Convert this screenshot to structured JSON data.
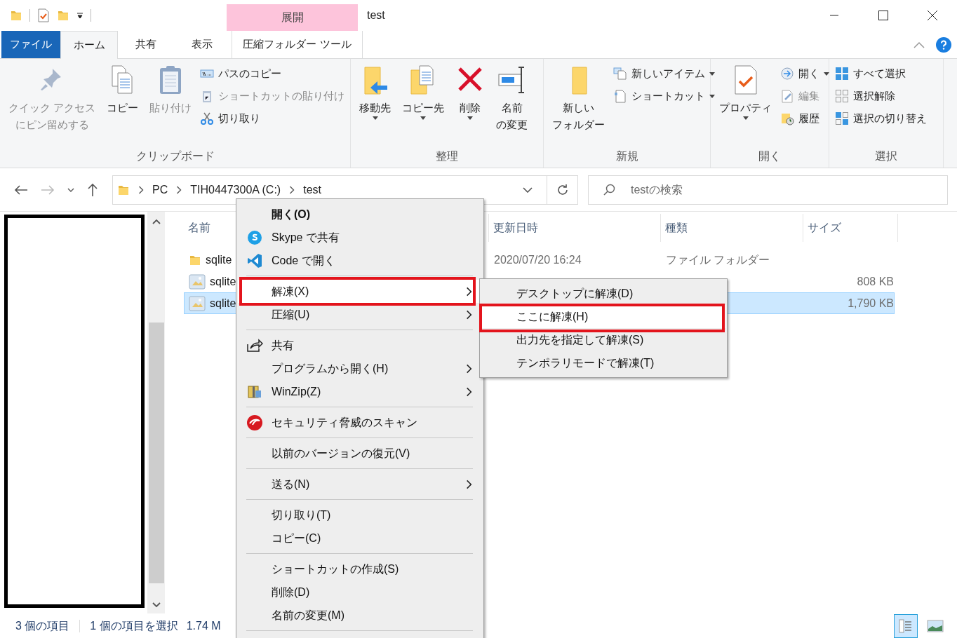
{
  "window": {
    "title": "test"
  },
  "contextual_group": {
    "label": "展開",
    "tab": {
      "label": "圧縮フォルダー ツール",
      "selected": false
    }
  },
  "tabs": [
    {
      "label": "ファイル",
      "kind": "file",
      "selected": false
    },
    {
      "label": "ホーム",
      "kind": "tab",
      "selected": true
    },
    {
      "label": "共有",
      "kind": "tab",
      "selected": false
    },
    {
      "label": "表示",
      "kind": "tab",
      "selected": false
    }
  ],
  "ribbon": [
    {
      "label": "クリップボード",
      "large": [
        {
          "lines": [
            "クイック アクセス",
            "にピン留めする"
          ],
          "disabled": true,
          "dropdown": false
        },
        {
          "label": "コピー",
          "disabled": false,
          "dropdown": false
        },
        {
          "label": "貼り付け",
          "disabled": true,
          "dropdown": false
        }
      ],
      "small": [
        {
          "label": "パスのコピー",
          "disabled": false,
          "dropdown": false
        },
        {
          "label": "ショートカットの貼り付け",
          "disabled": true,
          "dropdown": false
        },
        {
          "label": "切り取り",
          "disabled": false,
          "dropdown": false
        }
      ]
    },
    {
      "label": "整理",
      "large": [
        {
          "label": "移動先",
          "disabled": false,
          "dropdown": true
        },
        {
          "label": "コピー先",
          "disabled": false,
          "dropdown": true
        },
        {
          "label": "削除",
          "disabled": false,
          "dropdown": true
        },
        {
          "lines": [
            "名前",
            "の変更"
          ],
          "disabled": false,
          "dropdown": false
        }
      ]
    },
    {
      "label": "新規",
      "large": [
        {
          "lines": [
            "新しい",
            "フォルダー"
          ],
          "disabled": false,
          "dropdown": false
        }
      ],
      "small": [
        {
          "label": "新しいアイテム",
          "disabled": false,
          "dropdown": true
        },
        {
          "label": "ショートカット",
          "disabled": false,
          "dropdown": true
        }
      ]
    },
    {
      "label": "開く",
      "large": [
        {
          "label": "プロパティ",
          "disabled": false,
          "dropdown": true
        }
      ],
      "small": [
        {
          "label": "開く",
          "disabled": false,
          "dropdown": true
        },
        {
          "label": "編集",
          "disabled": true,
          "dropdown": false
        },
        {
          "label": "履歴",
          "disabled": false,
          "dropdown": false
        }
      ]
    },
    {
      "label": "選択",
      "small": [
        {
          "label": "すべて選択",
          "disabled": false,
          "dropdown": false
        },
        {
          "label": "選択解除",
          "disabled": false,
          "dropdown": false
        },
        {
          "label": "選択の切り替え",
          "disabled": false,
          "dropdown": false
        }
      ]
    }
  ],
  "address": {
    "segments": [
      "PC",
      "TIH0447300A (C:)",
      "test"
    ]
  },
  "search": {
    "placeholder": "testの検索"
  },
  "columns": [
    "名前",
    "更新日時",
    "種類",
    "サイズ"
  ],
  "rows": [
    {
      "name": "sqlite",
      "kind": "folder",
      "date": "2020/07/20 16:24",
      "type": "ファイル フォルダー",
      "selected": false
    },
    {
      "name": "sqlite",
      "kind": "archive",
      "size": "808 KB",
      "selected": false
    },
    {
      "name": "sqlite",
      "kind": "archive",
      "size": "1,790 KB",
      "selected": true
    }
  ],
  "status_bar": {
    "count": "3 個の項目",
    "selection": "1 個の項目を選択",
    "size": "1.74 M"
  },
  "view_buttons": [
    {
      "kind": "details",
      "selected": true
    },
    {
      "kind": "preview",
      "selected": false
    }
  ],
  "context_menu": [
    {
      "kind": "item",
      "label": "開く(O)",
      "bold": true,
      "submenu": false,
      "selected": false,
      "annotated": false
    },
    {
      "kind": "item",
      "label": "Skype で共有",
      "bold": false,
      "submenu": false,
      "selected": false,
      "annotated": false
    },
    {
      "kind": "item",
      "label": "Code で開く",
      "bold": false,
      "submenu": false,
      "selected": false,
      "annotated": false
    },
    {
      "kind": "separator"
    },
    {
      "kind": "item",
      "label": "解凍(X)",
      "bold": false,
      "submenu": true,
      "selected": true,
      "annotated": true
    },
    {
      "kind": "item",
      "label": "圧縮(U)",
      "bold": false,
      "submenu": true,
      "selected": false,
      "annotated": false
    },
    {
      "kind": "separator"
    },
    {
      "kind": "item",
      "label": "共有",
      "bold": false,
      "submenu": false,
      "selected": false,
      "annotated": false
    },
    {
      "kind": "item",
      "label": "プログラムから開く(H)",
      "bold": false,
      "submenu": true,
      "selected": false,
      "annotated": false
    },
    {
      "kind": "item",
      "label": "WinZip(Z)",
      "bold": false,
      "submenu": true,
      "selected": false,
      "annotated": false
    },
    {
      "kind": "separator"
    },
    {
      "kind": "item",
      "label": "セキュリティ脅威のスキャン",
      "bold": false,
      "submenu": false,
      "selected": false,
      "annotated": false
    },
    {
      "kind": "separator"
    },
    {
      "kind": "item",
      "label": "以前のバージョンの復元(V)",
      "bold": false,
      "submenu": false,
      "selected": false,
      "annotated": false
    },
    {
      "kind": "separator"
    },
    {
      "kind": "item",
      "label": "送る(N)",
      "bold": false,
      "submenu": true,
      "selected": false,
      "annotated": false
    },
    {
      "kind": "separator"
    },
    {
      "kind": "item",
      "label": "切り取り(T)",
      "bold": false,
      "submenu": false,
      "selected": false,
      "annotated": false
    },
    {
      "kind": "item",
      "label": "コピー(C)",
      "bold": false,
      "submenu": false,
      "selected": false,
      "annotated": false
    },
    {
      "kind": "separator"
    },
    {
      "kind": "item",
      "label": "ショートカットの作成(S)",
      "bold": false,
      "submenu": false,
      "selected": false,
      "annotated": false
    },
    {
      "kind": "item",
      "label": "削除(D)",
      "bold": false,
      "submenu": false,
      "selected": false,
      "annotated": false
    },
    {
      "kind": "item",
      "label": "名前の変更(M)",
      "bold": false,
      "submenu": false,
      "selected": false,
      "annotated": false
    },
    {
      "kind": "separator"
    }
  ],
  "submenu": [
    {
      "label": "デスクトップに解凍(D)",
      "selected": false,
      "annotated": false
    },
    {
      "label": "ここに解凍(H)",
      "selected": true,
      "annotated": true
    },
    {
      "label": "出力先を指定して解凍(S)",
      "selected": false,
      "annotated": false
    },
    {
      "label": "テンポラリモードで解凍(T)",
      "selected": false,
      "annotated": false
    }
  ]
}
